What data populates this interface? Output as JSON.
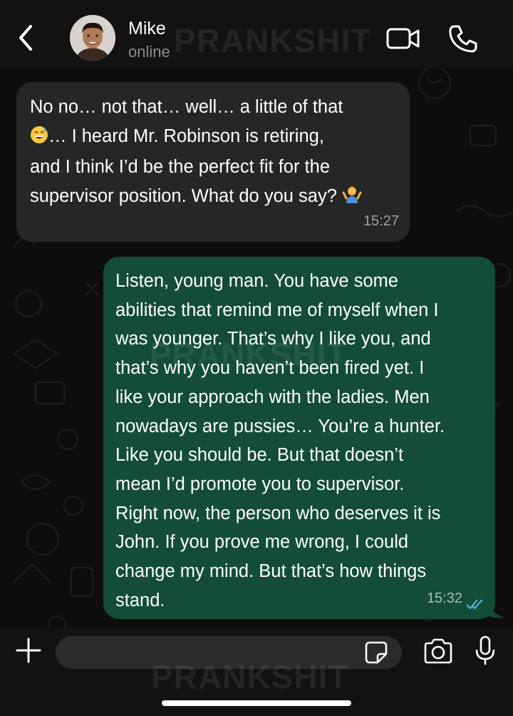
{
  "header": {
    "back_icon": "chevron-left-icon",
    "contact_name": "Mike",
    "contact_status": "online",
    "video_icon": "video-camera-icon",
    "call_icon": "phone-icon"
  },
  "watermark": "PRANKSHIT",
  "messages": [
    {
      "direction": "incoming",
      "text_part1": "No no… not that… well… a little of that\n",
      "emoji1": "grinning-sweat-emoji",
      "text_part2": "… I heard Mr. Robinson is retiring,\nand I think I’d be the perfect fit for the\nsupervisor position. What do you say? ",
      "emoji2": "person-shrugging-emoji",
      "time": "15:27"
    },
    {
      "direction": "outgoing",
      "text": "Listen, young man. You have some\nabilities that remind me of myself when I\nwas younger. That’s why I like you, and\nthat’s why you haven’t been fired yet. I\nlike your approach with the ladies. Men\nnowadays are pussies… You’re a hunter.\nLike you should be. But that doesn’t\nmean I’d promote you to supervisor.\nRight now, the person who deserves it is\nJohn. If you prove me wrong, I could\nchange my mind. But that’s how things\nstand.",
      "time": "15:32",
      "status_icon": "double-check-read-icon"
    }
  ],
  "input_bar": {
    "plus_icon": "plus-icon",
    "message_value": "",
    "sticker_icon": "sticker-icon",
    "camera_icon": "camera-icon",
    "mic_icon": "microphone-icon"
  },
  "colors": {
    "incoming_bubble": "#262626",
    "outgoing_bubble": "#134d37",
    "read_ticks": "#53bdeb",
    "header_bg": "#121212"
  }
}
